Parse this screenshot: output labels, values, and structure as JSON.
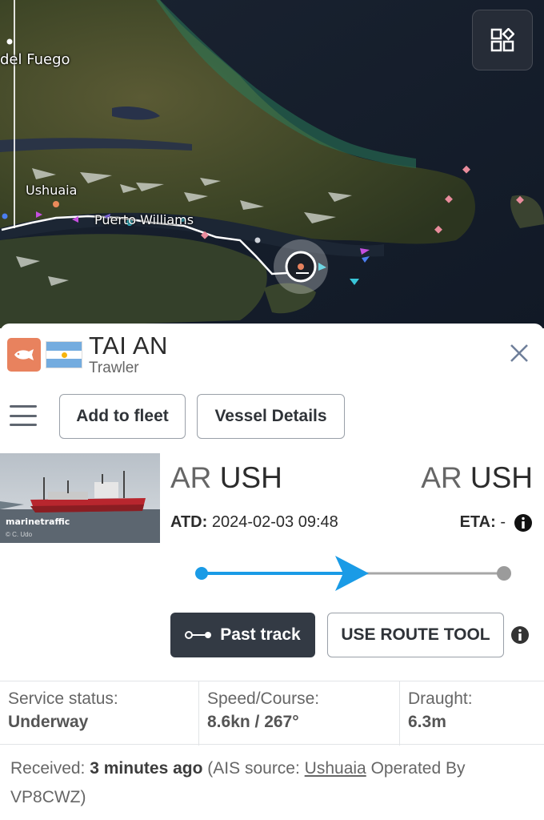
{
  "map": {
    "labels": {
      "tierra_del_fuego": "del Fuego",
      "ushuaia": "Ushuaia",
      "puerto_williams": "Puerto Williams"
    },
    "layers_icon": "layers-grid-icon",
    "colors": {
      "track": "#ffffff",
      "sea": "#141c28",
      "land": "#3f4a2a"
    }
  },
  "vessel": {
    "name": "TAI AN",
    "type": "Trawler",
    "type_icon": "fish-icon",
    "flag_country": "Argentina",
    "type_color": "#e8825e"
  },
  "actions": {
    "add_to_fleet": "Add to fleet",
    "vessel_details": "Vessel Details"
  },
  "photo": {
    "watermark": "marinetraffic",
    "credit": "© C. Udo"
  },
  "voyage": {
    "departure_country": "AR",
    "departure_port": "USH",
    "arrival_country": "AR",
    "arrival_port": "USH",
    "atd_label": "ATD:",
    "atd_value": "2024-02-03 09:48",
    "eta_label": "ETA:",
    "eta_value": "-",
    "progress_fraction": 0.5,
    "progress_color": "#1a9be6"
  },
  "track": {
    "past_track": "Past track",
    "use_route_tool": "USE ROUTE TOOL"
  },
  "stats": {
    "service_label": "Service status:",
    "service_value": "Underway",
    "speed_label": "Speed/Course:",
    "speed_value": "8.6kn / 267°",
    "draught_label": "Draught:",
    "draught_value": "6.3m"
  },
  "received": {
    "prefix": "Received:",
    "time": "3 minutes ago",
    "source_prefix": "(AIS source:",
    "source": "Ushuaia",
    "operated": "Operated By",
    "operator": "VP8CWZ)"
  }
}
